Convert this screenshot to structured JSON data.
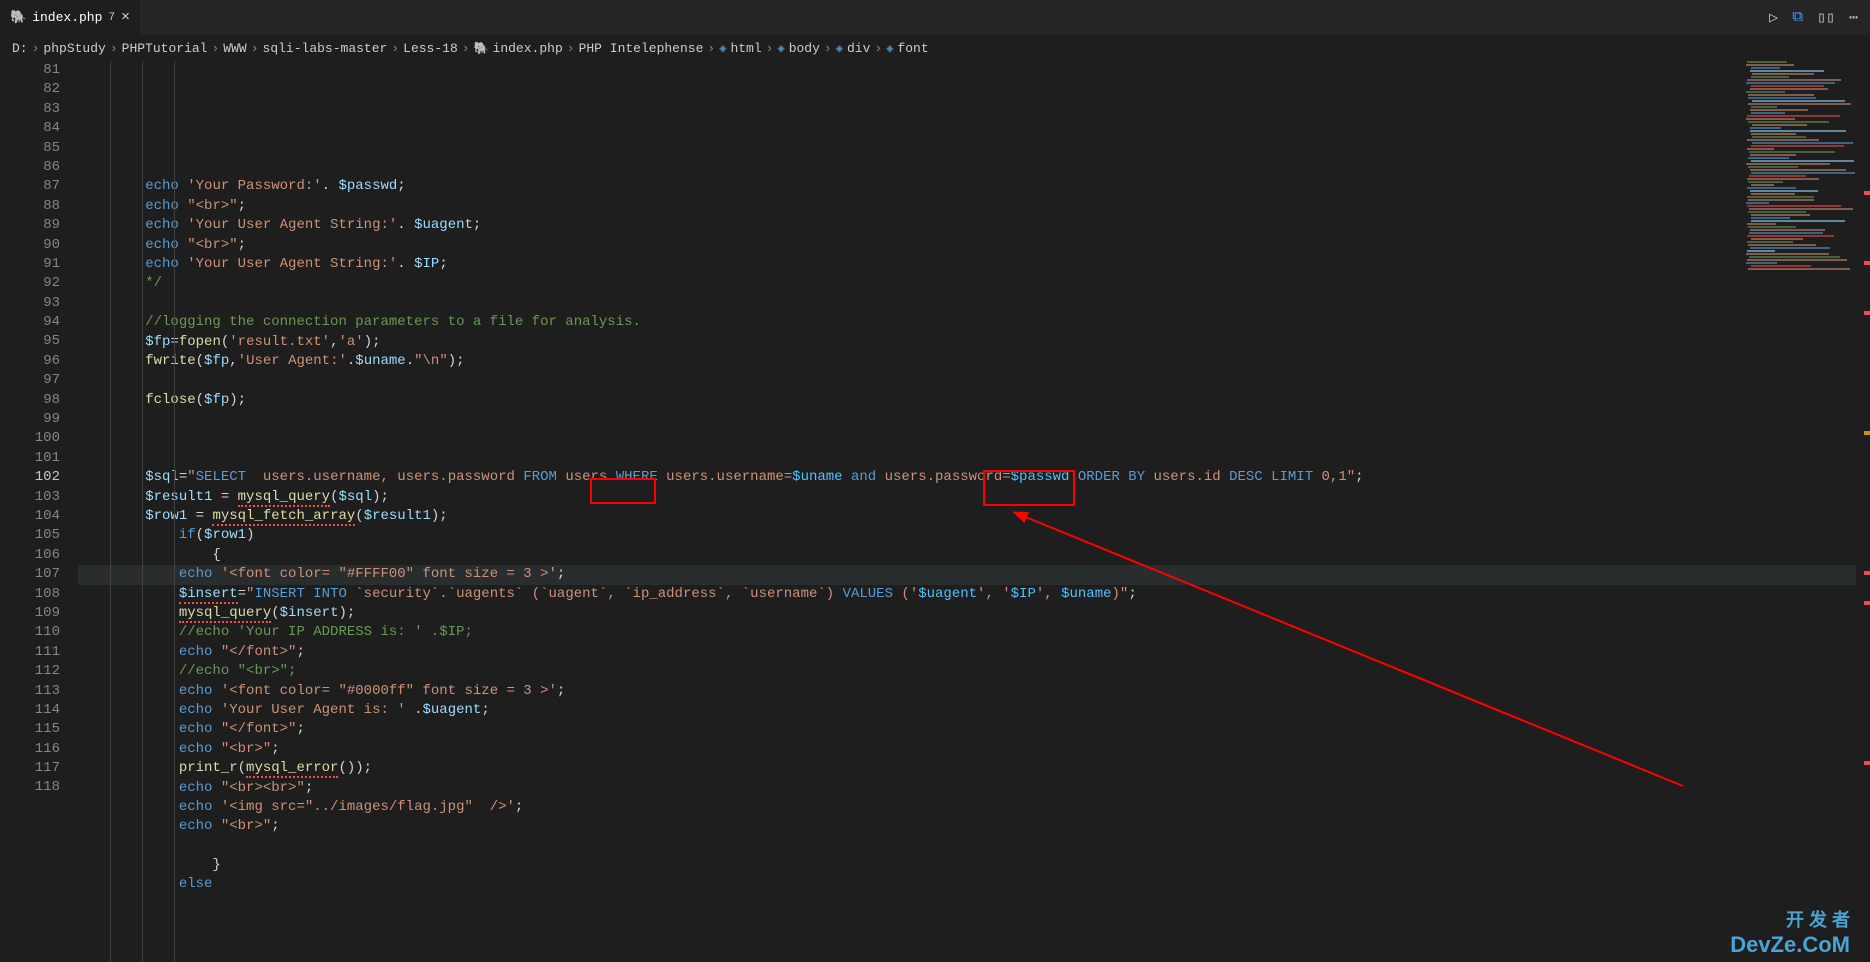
{
  "tab": {
    "icon": "🐘",
    "filename": "index.php",
    "badge": "7",
    "close": "×"
  },
  "actions": {
    "run": "▷",
    "compare": "⧉",
    "split": "▯▯",
    "more": "⋯"
  },
  "breadcrumb": {
    "parts": [
      {
        "label": "D:",
        "icon": ""
      },
      {
        "label": "phpStudy",
        "icon": ""
      },
      {
        "label": "PHPTutorial",
        "icon": ""
      },
      {
        "label": "WWW",
        "icon": ""
      },
      {
        "label": "sqli-labs-master",
        "icon": ""
      },
      {
        "label": "Less-18",
        "icon": ""
      },
      {
        "label": "index.php",
        "icon": "🐘"
      },
      {
        "label": "PHP Intelephense",
        "icon": ""
      },
      {
        "label": "html",
        "icon": "◈"
      },
      {
        "label": "body",
        "icon": "◈"
      },
      {
        "label": "div",
        "icon": "◈"
      },
      {
        "label": "font",
        "icon": "◈"
      }
    ],
    "sep": "›"
  },
  "lines": {
    "start": 81,
    "current": 102,
    "nums": [
      "81",
      "82",
      "83",
      "84",
      "85",
      "86",
      "87",
      "88",
      "89",
      "90",
      "91",
      "92",
      "93",
      "94",
      "95",
      "96",
      "97",
      "98",
      "99",
      "100",
      "101",
      "102",
      "103",
      "104",
      "105",
      "106",
      "107",
      "108",
      "109",
      "110",
      "111",
      "112",
      "113",
      "114",
      "115",
      "116",
      "117",
      "118"
    ]
  },
  "code": {
    "82": {
      "pre": "        ",
      "a": "echo ",
      "b": "'Your Password:'",
      "c": ". ",
      "d": "$passwd",
      "e": ";"
    },
    "83": {
      "pre": "        ",
      "a": "echo ",
      "b": "\"<br>\"",
      "c": ";"
    },
    "84": {
      "pre": "        ",
      "a": "echo ",
      "b": "'Your User Agent String:'",
      "c": ". ",
      "d": "$uagent",
      "e": ";"
    },
    "85": {
      "pre": "        ",
      "a": "echo ",
      "b": "\"<br>\"",
      "c": ";"
    },
    "86": {
      "pre": "        ",
      "a": "echo ",
      "b": "'Your User Agent String:'",
      "c": ". ",
      "d": "$IP",
      "e": ";"
    },
    "87": {
      "pre": "        ",
      "a": "*/"
    },
    "89": {
      "pre": "        ",
      "a": "//logging the connection parameters to a file for analysis."
    },
    "90": {
      "pre": "        ",
      "a": "$fp",
      "b": "=",
      "c": "fopen",
      "d": "(",
      "e": "'result.txt'",
      "f": ",",
      "g": "'a'",
      "h": ");"
    },
    "91": {
      "pre": "        ",
      "a": "fwrite",
      "b": "(",
      "c": "$fp",
      "d": ",",
      "e": "'User Agent:'",
      "f": ".",
      "g": "$uname",
      "h": ".",
      "i": "\"\\n\"",
      "j": ");"
    },
    "93": {
      "pre": "        ",
      "a": "fclose",
      "b": "(",
      "c": "$fp",
      "d": ");"
    },
    "97": {
      "pre": "        ",
      "a": "$sql",
      "b": "=",
      "c": "\"",
      "d": "SELECT",
      "e": "  users.username, users.password ",
      "f": "FROM",
      "g": " users ",
      "h": "WHERE",
      "i": " users.username=",
      "j": "$uname",
      "k": " ",
      "l": "and",
      "m": " users.password=",
      "n": "$passwd",
      "o": " ",
      "p": "ORDER BY",
      "q": " users.id ",
      "r": "DESC LIMIT",
      "s": " 0,1\"",
      "t": ";"
    },
    "98": {
      "pre": "        ",
      "a": "$result1",
      "b": " = ",
      "c": "mysql_query",
      "d": "(",
      "e": "$sql",
      "f": ");"
    },
    "99": {
      "pre": "        ",
      "a": "$row1",
      "b": " = ",
      "c": "mysql_fetch_array",
      "d": "(",
      "e": "$result1",
      "f": ");"
    },
    "100": {
      "pre": "            ",
      "a": "if",
      "b": "(",
      "c": "$row1",
      "d": ")"
    },
    "101": {
      "pre": "                ",
      "a": "{"
    },
    "102": {
      "pre": "            ",
      "a": "echo ",
      "b": "'<font color= \"#FFFF00\" font size = 3 >'",
      "c": ";"
    },
    "103": {
      "pre": "            ",
      "a": "$insert",
      "b": "=",
      "c": "\"",
      "d": "INSERT INTO",
      "e": " `security`.`uagents` (`",
      "f": "uagent",
      "g": "`, `ip_address`, `username`) ",
      "h": "VALUES",
      "i": " (",
      "j": "'",
      "k": "$uagent",
      "l": "'",
      "m": ", ",
      "n": "'",
      "o": "$IP",
      "p": "'",
      "q": ", ",
      "r": "$uname",
      "s": ")\"",
      "t": ";"
    },
    "104": {
      "pre": "            ",
      "a": "mysql_query",
      "b": "(",
      "c": "$insert",
      "d": ");"
    },
    "105": {
      "pre": "            ",
      "a": "//echo 'Your IP ADDRESS is: ' .$IP;"
    },
    "106": {
      "pre": "            ",
      "a": "echo ",
      "b": "\"</font>\"",
      "c": ";"
    },
    "107": {
      "pre": "            ",
      "a": "//echo \"<br>\";"
    },
    "108": {
      "pre": "            ",
      "a": "echo ",
      "b": "'<font color= \"#0000ff\" font size = 3 >'",
      "c": ";"
    },
    "109": {
      "pre": "            ",
      "a": "echo ",
      "b": "'Your User Agent is: '",
      "c": " .",
      "d": "$uagent",
      "e": ";"
    },
    "110": {
      "pre": "            ",
      "a": "echo ",
      "b": "\"</font>\"",
      "c": ";"
    },
    "111": {
      "pre": "            ",
      "a": "echo ",
      "b": "\"<br>\"",
      "c": ";"
    },
    "112": {
      "pre": "            ",
      "a": "print_r",
      "b": "(",
      "c": "mysql_error",
      "d": "());"
    },
    "113": {
      "pre": "            ",
      "a": "echo ",
      "b": "\"<br><br>\"",
      "c": ";"
    },
    "114": {
      "pre": "            ",
      "a": "echo ",
      "b": "'<img src=\"../images/flag.jpg\"  />'",
      "c": ";"
    },
    "115": {
      "pre": "            ",
      "a": "echo ",
      "b": "\"<br>\"",
      "c": ";"
    },
    "117": {
      "pre": "                ",
      "a": "}"
    },
    "118": {
      "pre": "            ",
      "a": "else"
    }
  },
  "watermark": {
    "cn": "开 发 者",
    "en": "DevZe.CoM"
  }
}
